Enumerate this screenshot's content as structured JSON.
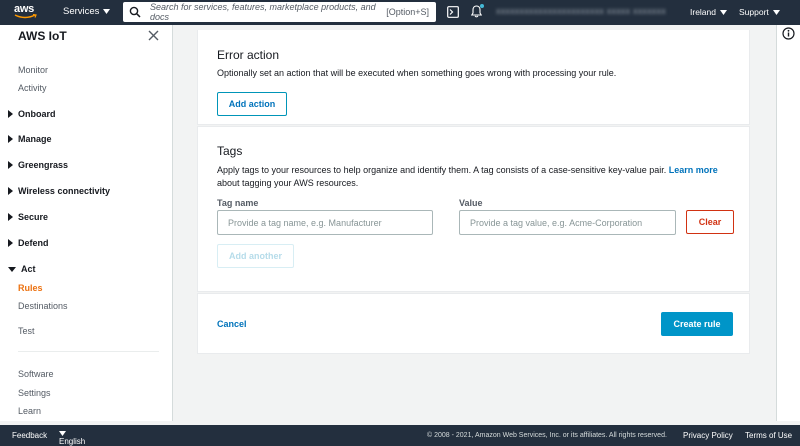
{
  "topnav": {
    "logo_text": "aws",
    "services_label": "Services",
    "search_placeholder": "Search for services, features, marketplace products, and docs",
    "search_shortcut": "[Option+S]",
    "account_name": "xxxxxxxxxxxxxxxxxxxxxxx xxxxx xxxxxxx",
    "region_label": "Ireland",
    "support_label": "Support"
  },
  "sidebar": {
    "title": "AWS IoT",
    "monitor": "Monitor",
    "activity": "Activity",
    "onboard": "Onboard",
    "manage": "Manage",
    "greengrass": "Greengrass",
    "wireless": "Wireless connectivity",
    "secure": "Secure",
    "defend": "Defend",
    "act": "Act",
    "rules": "Rules",
    "destinations": "Destinations",
    "test": "Test",
    "software": "Software",
    "settings": "Settings",
    "learn": "Learn"
  },
  "error_action": {
    "title": "Error action",
    "description": "Optionally set an action that will be executed when something goes wrong with processing your rule.",
    "add_action_label": "Add action"
  },
  "tags": {
    "title": "Tags",
    "description_pre": "Apply tags to your resources to help organize and identify them. A tag consists of a case-sensitive key-value pair.",
    "learn_more": "Learn more",
    "description_post": "about tagging your AWS resources.",
    "tag_name_label": "Tag name",
    "tag_name_placeholder": "Provide a tag name, e.g. Manufacturer",
    "value_label": "Value",
    "value_placeholder": "Provide a tag value, e.g. Acme-Corporation",
    "clear_label": "Clear",
    "add_another_label": "Add another"
  },
  "actions": {
    "cancel_label": "Cancel",
    "create_rule_label": "Create rule"
  },
  "footer": {
    "feedback": "Feedback",
    "language": "English (US)",
    "copyright": "© 2008 - 2021, Amazon Web Services, Inc. or its affiliates. All rights reserved.",
    "privacy": "Privacy Policy",
    "terms": "Terms of Use"
  },
  "colors": {
    "nav_bg": "#232f3e",
    "accent_orange": "#ec7211",
    "link_blue": "#0073bb",
    "primary_button": "#0095c8",
    "danger_red": "#d13212"
  }
}
